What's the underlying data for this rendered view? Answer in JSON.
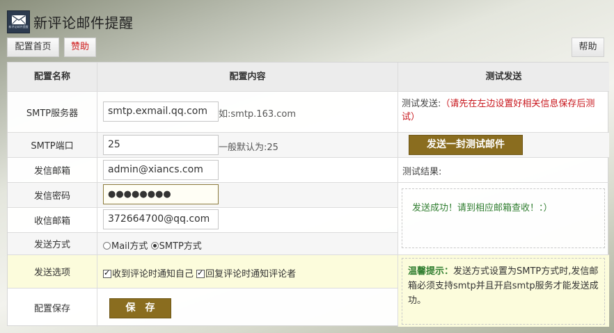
{
  "header": {
    "title": "新评论邮件提醒",
    "logo_icon": "mail-envelope-icon"
  },
  "toolbar": {
    "home_label": "配置首页",
    "sponsor_label": "赞助",
    "help_label": "帮助"
  },
  "table": {
    "headers": {
      "name": "配置名称",
      "content": "配置内容",
      "test": "测试发送"
    },
    "rows": {
      "smtp_server": {
        "label": "SMTP服务器",
        "value": "smtp.exmail.qq.com",
        "hint": "如:smtp.163.com"
      },
      "smtp_port": {
        "label": "SMTP端口",
        "value": "25",
        "hint": "一般默认为:25"
      },
      "sender_email": {
        "label": "发信邮箱",
        "value": "admin@xiancs.com"
      },
      "sender_password": {
        "label": "发信密码",
        "value": "●●●●●●●●"
      },
      "receiver_email": {
        "label": "收信邮箱",
        "value": "372664700@qq.com"
      },
      "send_method": {
        "label": "发送方式",
        "options": [
          "Mail方式",
          "SMTP方式"
        ],
        "selected": "SMTP方式"
      },
      "send_options": {
        "label": "发送选项",
        "options": [
          "收到评论时通知自己",
          "回复评论时通知评论者"
        ],
        "checked": [
          true,
          true
        ]
      },
      "save": {
        "label": "配置保存",
        "button": "保　存"
      }
    },
    "test": {
      "prefix": "测试发送:",
      "notice": "（请先在左边设置好相关信息保存后测试）",
      "send_button": "发送一封测试邮件",
      "result_label": "测试结果:",
      "result_text": "发送成功！请到相应邮箱查收！：）",
      "tip_title": "温馨提示：",
      "tip_text": "发送方式设置为SMTP方式时,发信邮箱必须支持smtp并且开启smtp服务才能发送成功。"
    }
  },
  "colors": {
    "accent": "#8a6d1f",
    "error": "#c8171d",
    "success": "#2f7d2f",
    "tip_bg": "#fcfcdc"
  }
}
